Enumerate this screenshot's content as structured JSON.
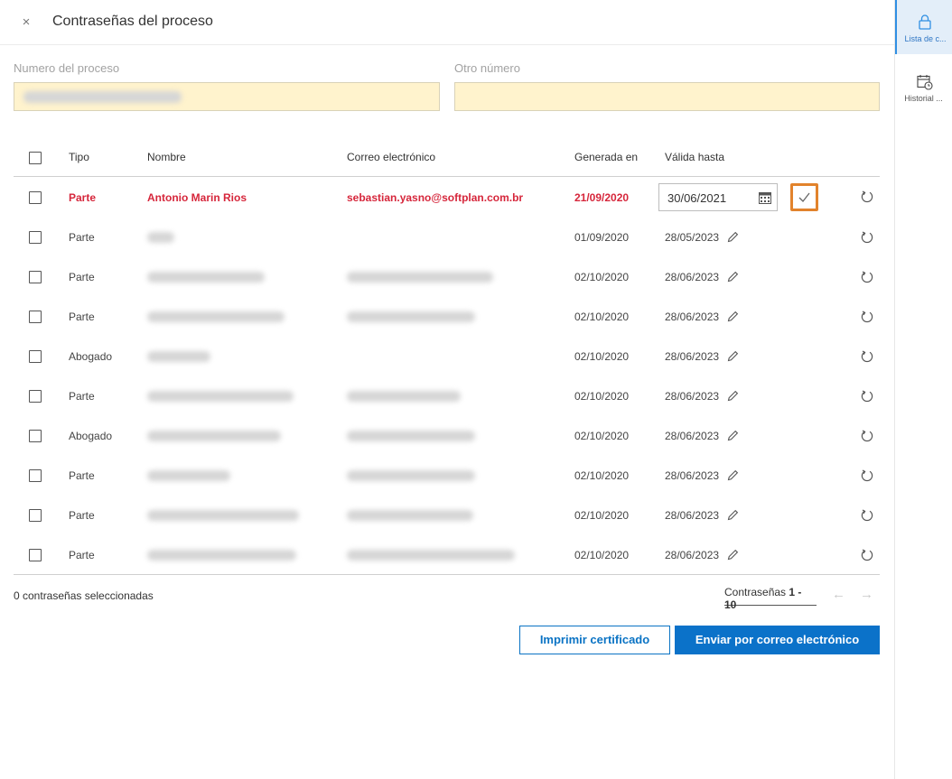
{
  "header": {
    "title": "Contraseñas del proceso",
    "close_label": "×"
  },
  "form": {
    "process_number_label": "Numero del proceso",
    "other_number_label": "Otro número"
  },
  "table": {
    "headers": {
      "tipo": "Tipo",
      "nombre": "Nombre",
      "correo": "Correo electrónico",
      "generada": "Generada en",
      "valida": "Válida hasta"
    },
    "editing_row": {
      "tipo": "Parte",
      "nombre": "Antonio Marin Rios",
      "correo": "sebastian.yasno@softplan.com.br",
      "generada": "21/09/2020",
      "valida_input": "30/06/2021"
    },
    "rows": [
      {
        "tipo": "Parte",
        "generada": "01/09/2020",
        "valida": "28/05/2023"
      },
      {
        "tipo": "Parte",
        "generada": "02/10/2020",
        "valida": "28/06/2023"
      },
      {
        "tipo": "Parte",
        "generada": "02/10/2020",
        "valida": "28/06/2023"
      },
      {
        "tipo": "Abogado",
        "generada": "02/10/2020",
        "valida": "28/06/2023"
      },
      {
        "tipo": "Parte",
        "generada": "02/10/2020",
        "valida": "28/06/2023"
      },
      {
        "tipo": "Abogado",
        "generada": "02/10/2020",
        "valida": "28/06/2023"
      },
      {
        "tipo": "Parte",
        "generada": "02/10/2020",
        "valida": "28/06/2023"
      },
      {
        "tipo": "Parte",
        "generada": "02/10/2020",
        "valida": "28/06/2023"
      },
      {
        "tipo": "Parte",
        "generada": "02/10/2020",
        "valida": "28/06/2023"
      }
    ]
  },
  "footer": {
    "selected_count": "0 contraseñas seleccionadas",
    "pager_label": "Contraseñas",
    "pager_range": "1 - 10",
    "prev_arrow": "←",
    "next_arrow": "→"
  },
  "actions": {
    "print_label": "Imprimir certificado",
    "email_label": "Enviar por correo electrónico"
  },
  "sidebar": {
    "items": [
      {
        "label": "Lista de c...",
        "icon": "lock-icon",
        "active": true
      },
      {
        "label": "Historial ...",
        "icon": "calendar-clock-icon",
        "active": false
      }
    ]
  },
  "colors": {
    "highlight_text": "#d6263b",
    "input_bg": "#fff3cd",
    "primary": "#0b72c9",
    "focus_outline": "#e2832c"
  }
}
